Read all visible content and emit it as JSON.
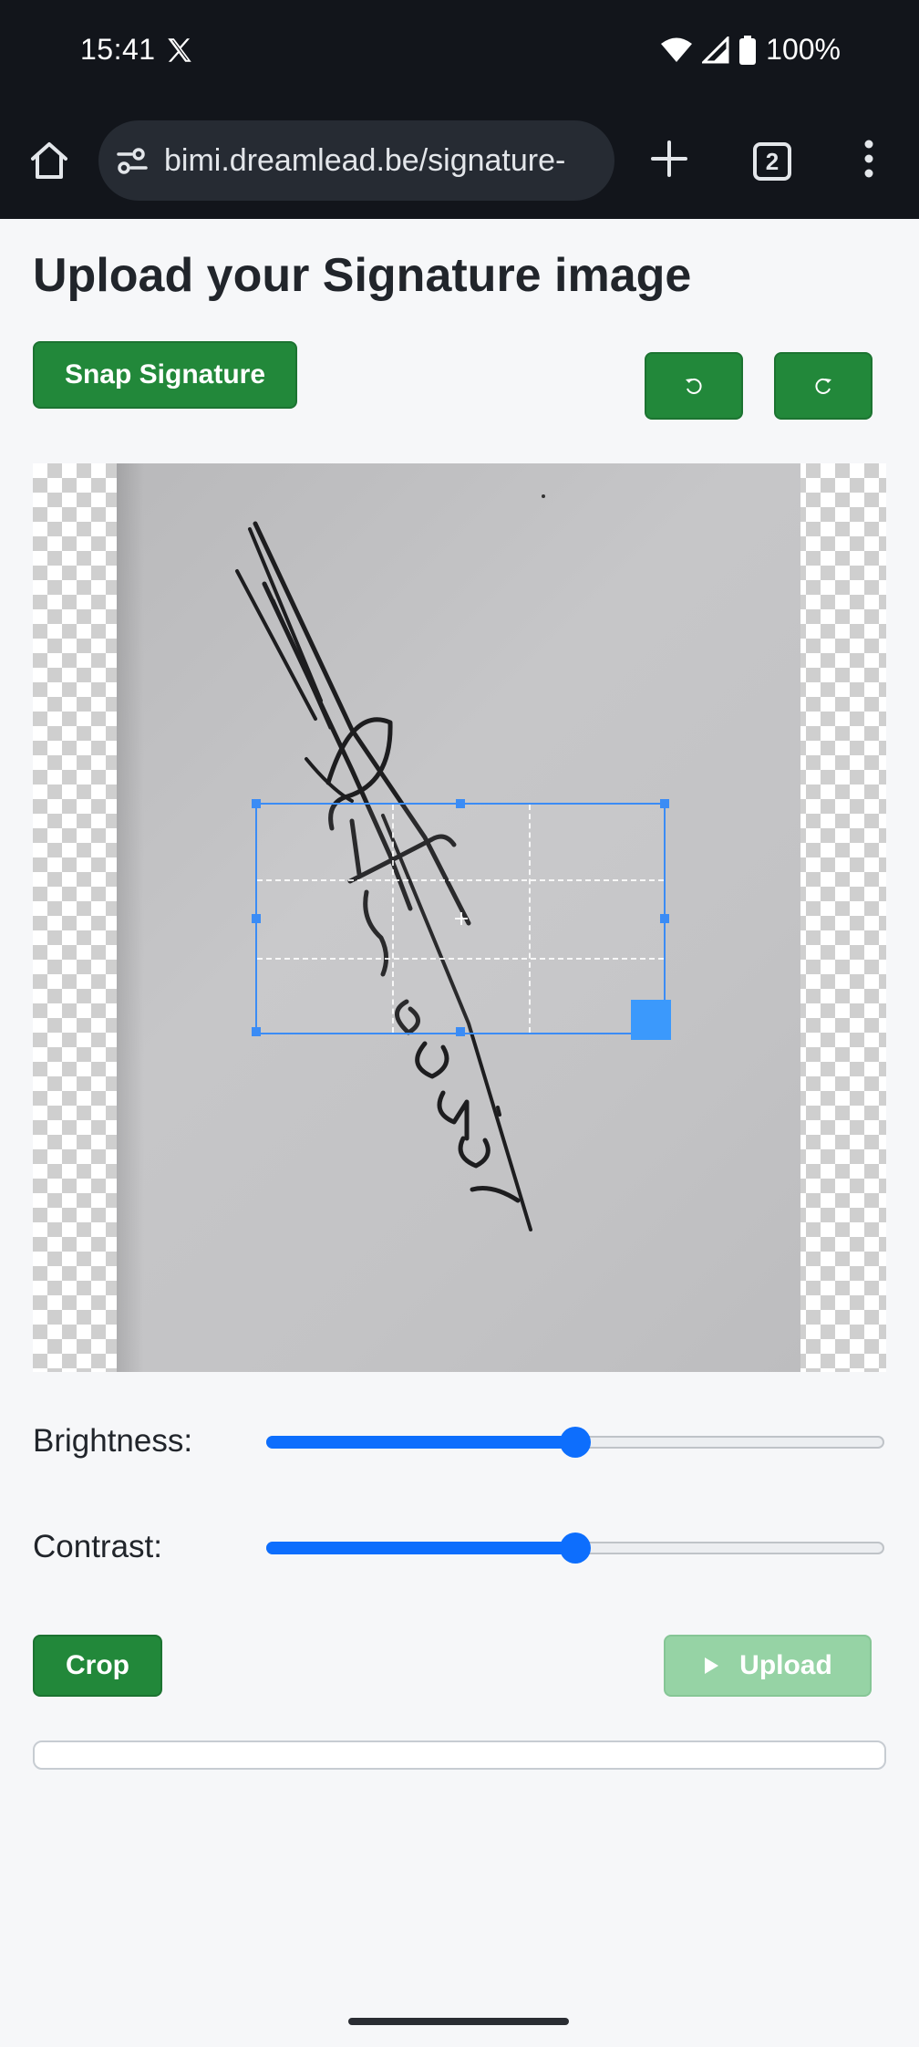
{
  "status_bar": {
    "time": "15:41",
    "battery": "100%",
    "icons": [
      "x-app-icon",
      "wifi-icon",
      "signal-icon",
      "battery-icon"
    ]
  },
  "browser": {
    "url": "bimi.dreamlead.be/signature-",
    "tab_count": "2",
    "icons": [
      "home-icon",
      "site-settings-icon",
      "plus-icon",
      "more-vert-icon"
    ]
  },
  "page": {
    "title": "Upload your Signature image",
    "snap_button": "Snap Signature",
    "rotate_left_symbol": "⟲",
    "rotate_right_symbol": "⟳"
  },
  "adjustments": {
    "brightness_label": "Brightness:",
    "brightness_value": 0.5,
    "contrast_label": "Contrast:",
    "contrast_value": 0.5
  },
  "actions": {
    "crop_button": "Crop",
    "upload_button": "Upload",
    "upload_enabled": false
  },
  "colors": {
    "primary_green": "#22883a",
    "disabled_green": "#96d3a5",
    "slider_blue": "#0d6efd",
    "crop_blue": "#3b8cf5",
    "status_bar_bg": "#12151b"
  }
}
